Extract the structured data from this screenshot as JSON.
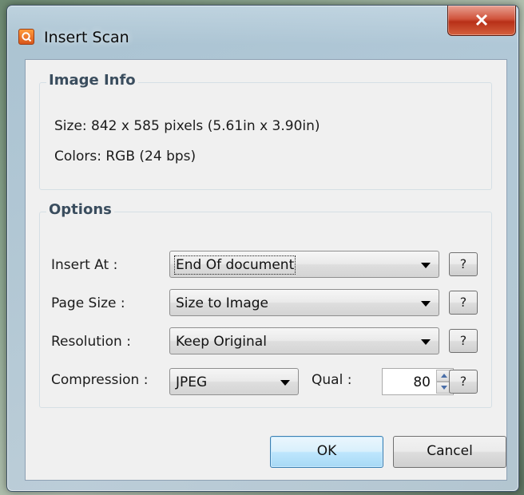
{
  "window": {
    "title": "Insert Scan",
    "app_icon": "app-logo-icon",
    "close_icon": "close-icon"
  },
  "image_info": {
    "heading": "Image Info",
    "size_line": "Size: 842 x 585 pixels (5.61in x 3.90in)",
    "colors_line": "Colors: RGB (24 bps)"
  },
  "options": {
    "heading": "Options",
    "insert_at": {
      "label": "Insert At :",
      "value": "End Of document"
    },
    "page_size": {
      "label": "Page Size :",
      "value": "Size to Image"
    },
    "resolution": {
      "label": "Resolution :",
      "value": "Keep Original"
    },
    "compression": {
      "label": "Compression :",
      "value": "JPEG"
    },
    "quality": {
      "label": "Qual :",
      "value": "80"
    },
    "help_label": "?"
  },
  "buttons": {
    "ok": "OK",
    "cancel": "Cancel"
  },
  "colors": {
    "close_button": "#c8452b",
    "ok_border": "#3c7fb1",
    "group_heading": "#3a4d5e"
  }
}
